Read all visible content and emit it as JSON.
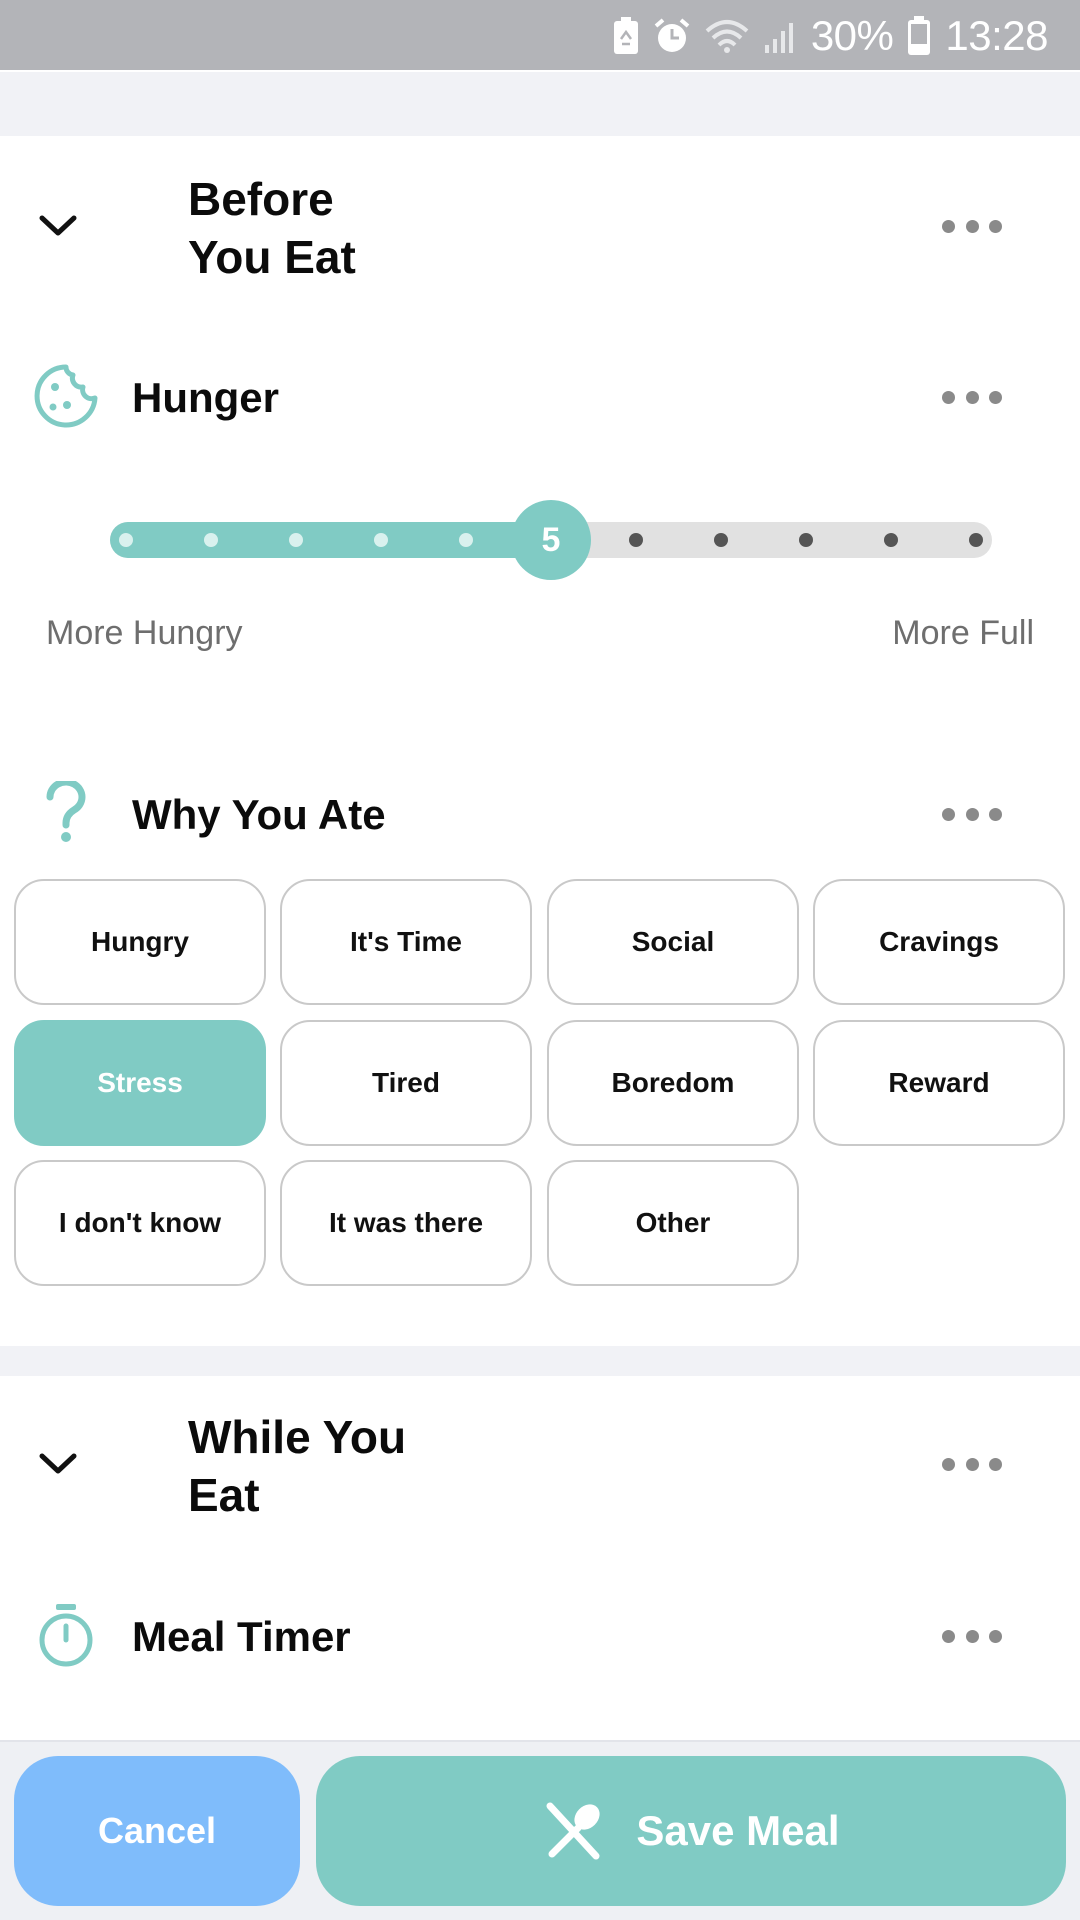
{
  "status_bar": {
    "battery_percent": "30%",
    "time": "13:28",
    "icons": [
      "recycle-battery-icon",
      "alarm-icon",
      "wifi-icon",
      "signal-icon",
      "battery-icon"
    ]
  },
  "before_section": {
    "title_line1": "Before",
    "title_line2": "You Eat",
    "hunger": {
      "label": "Hunger",
      "icon": "cookie-icon",
      "value": 5,
      "min_label": "More Hungry",
      "max_label": "More Full",
      "steps": 11
    },
    "why": {
      "label": "Why You Ate",
      "icon": "question-icon",
      "options": [
        {
          "label": "Hungry",
          "selected": false
        },
        {
          "label": "It's Time",
          "selected": false
        },
        {
          "label": "Social",
          "selected": false
        },
        {
          "label": "Cravings",
          "selected": false
        },
        {
          "label": "Stress",
          "selected": true
        },
        {
          "label": "Tired",
          "selected": false
        },
        {
          "label": "Boredom",
          "selected": false
        },
        {
          "label": "Reward",
          "selected": false
        },
        {
          "label": "I don't know",
          "selected": false
        },
        {
          "label": "It was there",
          "selected": false
        },
        {
          "label": "Other",
          "selected": false
        }
      ]
    }
  },
  "while_section": {
    "title_line1": "While You",
    "title_line2": "Eat",
    "meal_timer": {
      "label": "Meal Timer",
      "icon": "stopwatch-icon"
    }
  },
  "actions": {
    "cancel_label": "Cancel",
    "save_label": "Save Meal",
    "save_icon": "fork-spoon-icon"
  },
  "colors": {
    "accent": "#80cbc4",
    "cancel": "#7fbcfb",
    "track": "#e1e1e1"
  }
}
